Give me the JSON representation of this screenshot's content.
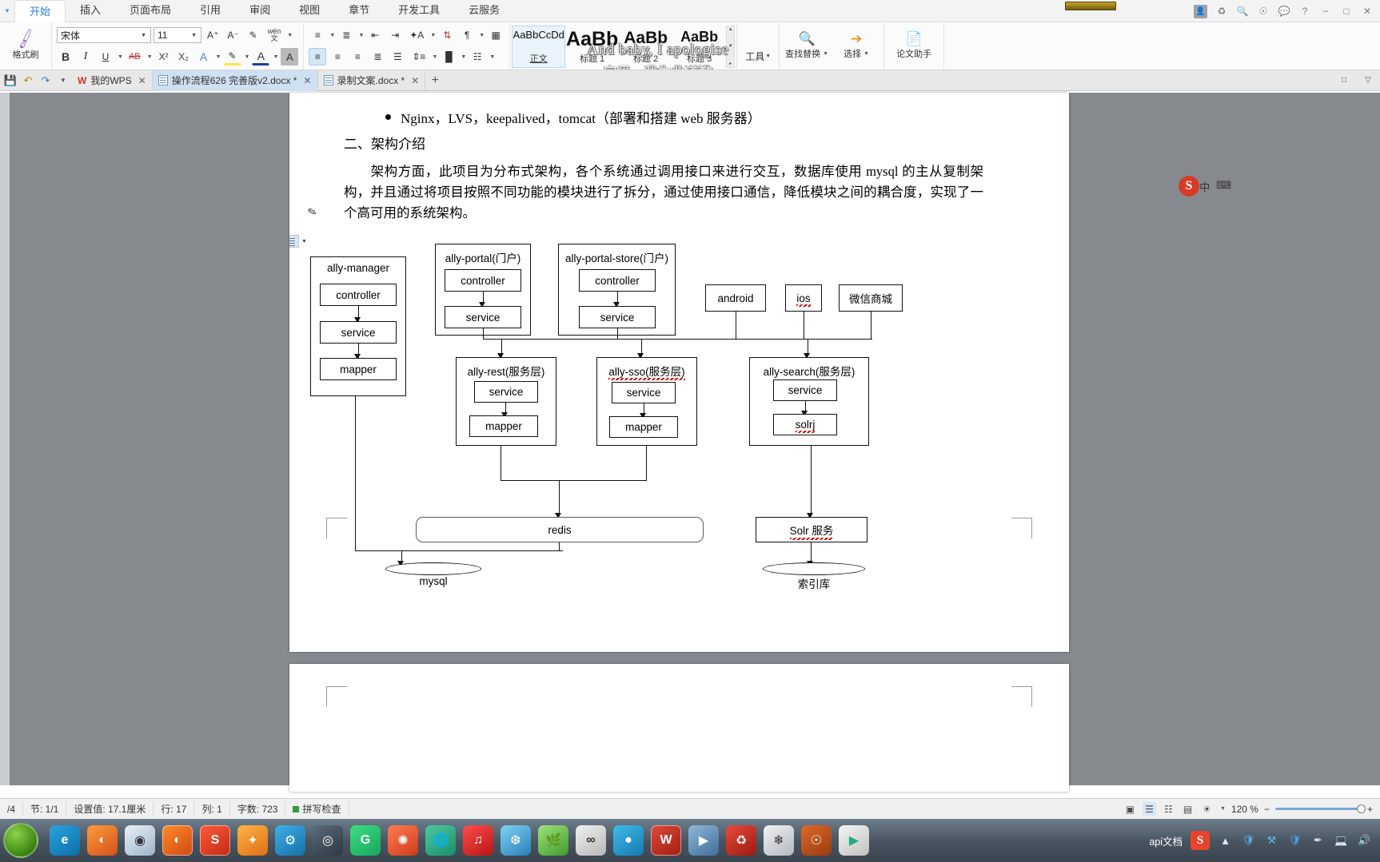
{
  "app": {
    "ribbon_tabs": [
      "开始",
      "插入",
      "页面布局",
      "引用",
      "审阅",
      "视图",
      "章节",
      "开发工具",
      "云服务"
    ],
    "active_tab": "开始",
    "window_controls": [
      "−",
      "□",
      "✕"
    ],
    "help_label": "?",
    "account_icon": "user-avatar-icon"
  },
  "lyric_overlay": {
    "line1": "And baby, I apologise",
    "line2": "宝贝，我为此道歉"
  },
  "ribbon": {
    "format_painter": {
      "label": "格式刷",
      "icon": "brush-icon"
    },
    "font": {
      "family": "宋体",
      "size": "11",
      "grow": "A⁺",
      "shrink": "A⁻",
      "clear_format": "clear-format-icon",
      "pinyin": "wén\n文",
      "bold": "B",
      "italic": "I",
      "underline": "U",
      "strike": "AB",
      "superscript": "X²",
      "subscript": "X₂",
      "text_effect": "A",
      "highlight": "highlight-icon",
      "font_color": "A",
      "char_shading": "A"
    },
    "paragraph": {
      "bullets": "bullet-list-icon",
      "numbering": "numbered-list-icon",
      "dec_indent": "decrease-indent-icon",
      "inc_indent": "increase-indent-icon",
      "asian_layout": "asian-layout-icon",
      "sort": "sort-icon",
      "show_marks": "show-marks-icon",
      "align_left": "align-left-icon",
      "align_center": "align-center-icon",
      "align_right": "align-right-icon",
      "align_justify": "align-justify-icon",
      "align_distribute": "align-distribute-icon",
      "line_spacing": "line-spacing-icon",
      "shading": "shading-icon",
      "borders": "borders-icon",
      "columns": "columns-icon",
      "pagination": "pagination-icon"
    },
    "styles": [
      {
        "preview": "AaBbCcDd",
        "name": "正文",
        "size": 13,
        "selected": true
      },
      {
        "preview": "AaBb",
        "name": "标题 1",
        "size": 25,
        "selected": false
      },
      {
        "preview": "AaBb",
        "name": "标题 2",
        "size": 21,
        "selected": false
      },
      {
        "preview": "AaBb",
        "name": "标题 3",
        "size": 18,
        "selected": false
      }
    ],
    "tools_label": "工具",
    "find_replace": {
      "label": "查找替换",
      "icon": "find-replace-icon"
    },
    "select": {
      "label": "选择",
      "icon": "cursor-arrow-icon"
    },
    "thesis_helper": {
      "label": "论文助手",
      "icon": "thesis-doc-icon"
    }
  },
  "doc_tabs": {
    "quick": [
      "save-icon",
      "undo-icon",
      "redo-icon",
      "customize-caret"
    ],
    "items": [
      {
        "label": "我的WPS",
        "icon": "wps-logo-icon",
        "active": false,
        "closable": true
      },
      {
        "label": "操作流程626 完善版v2.docx *",
        "icon": "doc-icon",
        "active": true,
        "closable": true
      },
      {
        "label": "录制文案.docx *",
        "icon": "doc-icon",
        "active": false,
        "closable": true
      }
    ],
    "new_tab": "+",
    "right_controls": [
      "restore-icon",
      "collapse-ribbon-icon"
    ]
  },
  "document": {
    "bullet_line": "Nginx，LVS，keepalived，tomcat（部署和搭建 web 服务器）",
    "heading": "二、架构介绍",
    "paragraph": "架构方面，此项目为分布式架构，各个系统通过调用接口来进行交互，数据库使用 mysql 的主从复制架构，并且通过将项目按照不同功能的模块进行了拆分，通过使用接口通信，降低模块之间的耦合度，实现了一个高可用的系统架构。",
    "object_button_icon": "layout-options-icon"
  },
  "diagram": {
    "groups": [
      {
        "title": "ally-manager",
        "children": [
          "controller",
          "service",
          "mapper"
        ]
      },
      {
        "title": "ally-portal(门户)",
        "children": [
          "controller",
          "service"
        ]
      },
      {
        "title": "ally-portal-store(门户)",
        "children": [
          "controller",
          "service"
        ]
      },
      {
        "title": "ally-rest(服务层)",
        "children": [
          "service",
          "mapper"
        ]
      },
      {
        "title": "ally-sso(服务层)",
        "children": [
          "service",
          "mapper"
        ]
      },
      {
        "title": "ally-search(服务层)",
        "children": [
          "service",
          "solrj"
        ]
      }
    ],
    "clients": [
      "android",
      "ios",
      "微信商城"
    ],
    "stores": [
      "redis",
      "Solr 服务"
    ],
    "databases": [
      "mysql",
      "索引库"
    ]
  },
  "status_bar": {
    "page": "/4",
    "section": "节: 1/1",
    "setting": "设置值: 17.1厘米",
    "row": "行: 17",
    "col": "列: 1",
    "words": "字数: 723",
    "spellcheck": "拼写检查",
    "zoom": "120 %",
    "zoom_out": "−",
    "zoom_in": "+",
    "view_icons": [
      "fullscreen-icon",
      "print-layout-icon",
      "outline-icon",
      "web-layout-icon",
      "night-mode-icon"
    ]
  },
  "taskbar": {
    "apps": [
      "start-orb",
      "edge-icon",
      "firefox-browser",
      "firefox-icon",
      "chrome-icon",
      "firefox-dev-icon",
      "sogou-icon",
      "flutter-icon",
      "app-icon-1",
      "steam-icon",
      "grammarly-icon",
      "app-icon-2",
      "globe-icon",
      "music-icon",
      "snowflake-icon",
      "leaf-icon",
      "knot-icon",
      "skype-icon",
      "wps-icon",
      "app-icon-3",
      "app-icon-4",
      "app-icon-5",
      "ubuntu-icon",
      "media-player-icon"
    ],
    "window_label": "api文档",
    "tray": [
      "show-hidden-icon",
      "shield-icon",
      "tools-icon",
      "security-icon",
      "pen-icon",
      "network-icon",
      "volume-icon"
    ],
    "sogou_badge": "S"
  },
  "ime": {
    "mode": "中",
    "shape": "⌨"
  }
}
